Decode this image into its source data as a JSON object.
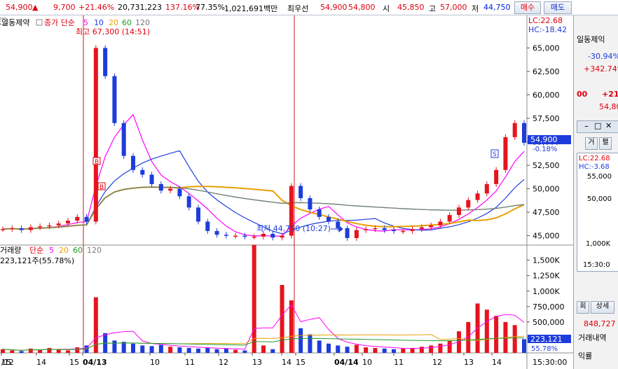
{
  "quote_bar": {
    "price": "54,900",
    "up_arrow": "▲",
    "change": "9,700",
    "change_pct": "+21.46%",
    "volume": "20,731,223",
    "vol_ratio": "137.16%",
    "turnover": "77.35%",
    "trade_value": "1,021,691백만",
    "priority_ask": "최우선",
    "ask_price": "54,900",
    "bid_price": "54,800",
    "open_label": "시",
    "open": "45,850",
    "high_label": "고",
    "high": "57,000",
    "low_label": "저",
    "low": "44,750",
    "buy_button": "매수",
    "sell_button": "매도"
  },
  "price_panel": {
    "stock_name": "일동제약",
    "legend_prefix": "종가 단순",
    "ma_labels": [
      "5",
      "10",
      "20",
      "60",
      "120"
    ],
    "high_note": "최고 67,300 (14:51)",
    "low_note": "최저 44,750 (10:27)",
    "lc": "LC:22.68",
    "hc": "HC:-18.42",
    "current_price_tag": "54,900",
    "current_pct_tag": "-0.18%",
    "signal_b": "B",
    "signal_s": "S",
    "y_ticks": [
      "65,000",
      "62,500",
      "60,000",
      "57,500",
      "55,000",
      "52,500",
      "50,000",
      "47,500",
      "45,000"
    ]
  },
  "volume_panel": {
    "title": "거래량",
    "legend_prefix": "단순",
    "ma_labels": [
      "5",
      "20",
      "60",
      "120"
    ],
    "current_note": "223,121주(55.78%)",
    "current_tag": "223,121",
    "current_pct_tag": "55.78%",
    "y_ticks": [
      "1,500K",
      "1,250K",
      "1,000K",
      "750,000",
      "500,000",
      "250,000"
    ]
  },
  "time_axis": {
    "labels": [
      "/12",
      "14",
      "15",
      "04/13",
      "10",
      "11",
      "12",
      "13",
      "14",
      "15",
      "04/14",
      "10",
      "11",
      "12",
      "13",
      "14",
      "15"
    ],
    "clock": "15:30:00"
  },
  "side_panel": {
    "name": "일동제익",
    "pct1": "-30.94%",
    "pct2": "+342.74%",
    "val1": "00",
    "val2": "+21",
    "val3": "54,80",
    "lc": "LC:22.68",
    "hc": "HC:-3.68",
    "tick1": "55,000",
    "tick2": "50,000",
    "tick3": "1,000K",
    "time": "15:30:0",
    "btn_geo": "거",
    "btn_pyeol": "펼",
    "btn_hoe": "회",
    "btn_sangse": "상세",
    "val_848": "848,727",
    "label_trades": "거래내역",
    "label_profit": "익률"
  },
  "chart_data": {
    "type": "line",
    "x_sessions": [
      "04/12",
      "04/13",
      "04/14"
    ],
    "price_series": [
      45700,
      45800,
      45600,
      45900,
      46000,
      46100,
      46300,
      46600,
      47000,
      46500,
      65000,
      62000,
      57000,
      53500,
      52000,
      51500,
      50500,
      49800,
      50000,
      49200,
      48000,
      46500,
      45500,
      45100,
      45000,
      45000,
      44900,
      44900,
      45200,
      44800,
      45000,
      50300,
      49000,
      47800,
      47000,
      46500,
      45800,
      44750,
      45600,
      45700,
      45800,
      45600,
      45500,
      45500,
      45700,
      45900,
      46100,
      46500,
      47200,
      48000,
      48800,
      49500,
      50500,
      52000,
      55500,
      57000,
      54900
    ],
    "volume_bars": [
      60,
      40,
      30,
      70,
      50,
      80,
      60,
      40,
      90,
      120,
      900,
      320,
      200,
      180,
      150,
      120,
      110,
      130,
      100,
      90,
      80,
      70,
      80,
      60,
      70,
      50,
      40,
      1750,
      120,
      60,
      1100,
      850,
      400,
      300,
      200,
      150,
      120,
      100,
      130,
      90,
      80,
      70,
      60,
      70,
      80,
      100,
      120,
      150,
      200,
      350,
      500,
      800,
      700,
      600,
      500,
      450,
      223
    ],
    "price_ylim": [
      44000,
      67500
    ],
    "volume_ylim": [
      0,
      1700000
    ],
    "moving_averages": [
      "5",
      "10",
      "20",
      "60",
      "120"
    ],
    "colors": {
      "up": "#e6141e",
      "down": "#1e3cdc",
      "ma5": "#ff00ff",
      "ma10": "#2040e0",
      "ma20": "#e8a000",
      "ma60": "#1f9d2a",
      "ma120": "#7a7a7a"
    }
  }
}
